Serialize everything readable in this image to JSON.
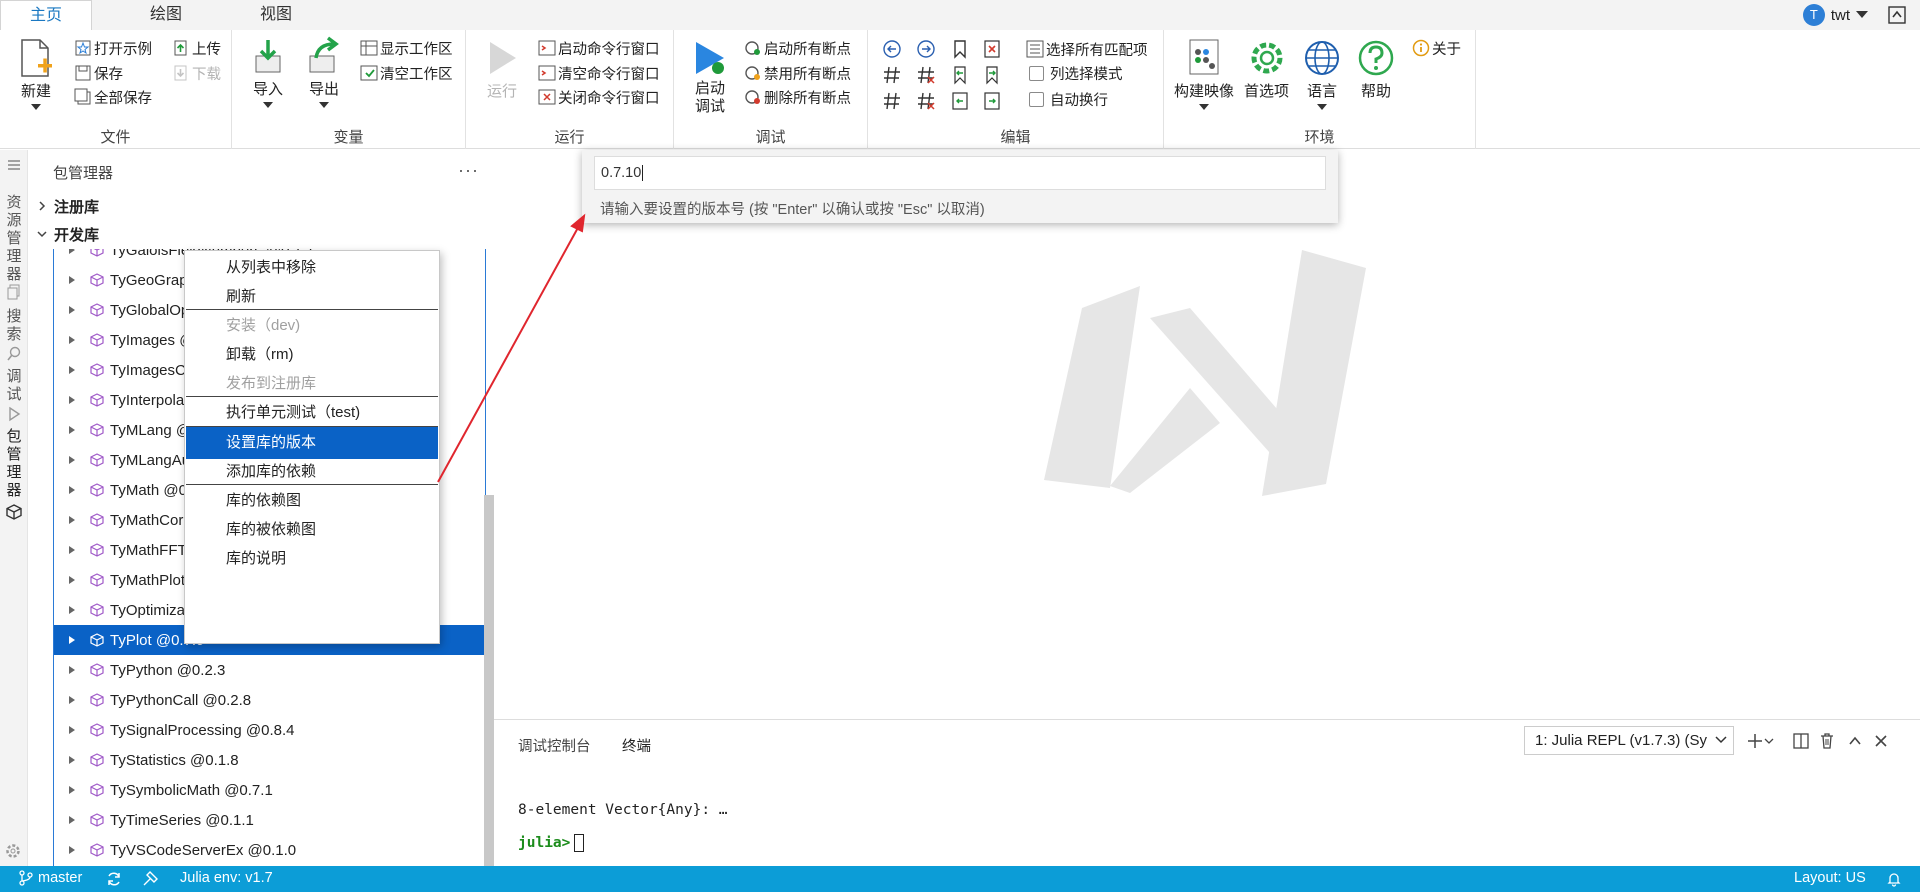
{
  "ribbon": {
    "tabs": [
      "主页",
      "绘图",
      "视图"
    ],
    "user": {
      "initial": "T",
      "name": "twt"
    },
    "groups": {
      "file": {
        "label": "文件",
        "new": "新建",
        "open_example": "打开示例",
        "save": "保存",
        "save_all": "全部保存",
        "upload": "上传",
        "download": "下载"
      },
      "variable": {
        "label": "变量",
        "import": "导入",
        "export": "导出",
        "show_workspace": "显示工作区",
        "clear_workspace": "清空工作区"
      },
      "run": {
        "label": "运行",
        "run": "运行",
        "start_cmd": "启动命令行窗口",
        "clear_cmd": "清空命令行窗口",
        "close_cmd": "关闭命令行窗口"
      },
      "debug": {
        "label": "调试",
        "start_debug": "启动调试",
        "enable_bp": "启动所有断点",
        "disable_bp": "禁用所有断点",
        "delete_bp": "删除所有断点"
      },
      "edit": {
        "label": "编辑",
        "select_all_matches": "选择所有匹配项",
        "column_select": "列选择模式",
        "word_wrap": "自动换行"
      },
      "env": {
        "label": "环境",
        "build_image": "构建映像",
        "preferences": "首选项",
        "language": "语言",
        "help": "帮助",
        "about": "关于"
      }
    }
  },
  "activity": [
    {
      "label": "资源管理器",
      "chars": [
        "资",
        "源",
        "管",
        "理",
        "器"
      ],
      "icon": "files-icon"
    },
    {
      "label": "搜索",
      "chars": [
        "搜",
        "索"
      ],
      "icon": "search-icon"
    },
    {
      "label": "调试",
      "chars": [
        "调",
        "试"
      ],
      "icon": "debug-icon"
    },
    {
      "label": "包管理器",
      "chars": [
        "包",
        "管",
        "理",
        "器"
      ],
      "icon": "package-icon"
    }
  ],
  "sidebar": {
    "title": "包管理器",
    "more": "···",
    "sections": {
      "registry": "注册库",
      "dev": "开发库"
    },
    "packages": [
      "TyGaloisFieldNumbers @0.1.1",
      "TyGeoGraphics @0.1.1",
      "TyGlobalOptimization @0.1.1",
      "TyImages @0.3.0",
      "TyImagesCore @0.1.0",
      "TyInterpolation @0.1.2",
      "TyMLang @0.1.0",
      "TyMLangAux @0.1.0",
      "TyMath @0.1.3",
      "TyMathCore @0.1.2",
      "TyMathFFT @0.1.1",
      "TyMathPlot @0.1.0",
      "TyOptimization @0.1.3",
      "TyPlot @0.7.9",
      "TyPython @0.2.3",
      "TyPythonCall @0.2.8",
      "TySignalProcessing @0.8.4",
      "TyStatistics @0.1.8",
      "TySymbolicMath @0.7.1",
      "TyTimeSeries @0.1.1",
      "TyVSCodeServerEx @0.1.0"
    ],
    "selected_index": 13
  },
  "context_menu": {
    "items": [
      {
        "label": "从列表中移除",
        "disabled": false
      },
      {
        "label": "刷新",
        "disabled": false
      },
      {
        "label": "安装（dev)",
        "disabled": true
      },
      {
        "label": "卸载（rm)",
        "disabled": false
      },
      {
        "label": "发布到注册库",
        "disabled": true
      },
      {
        "label": "执行单元测试（test)",
        "disabled": false
      },
      {
        "label": "设置库的版本",
        "disabled": false
      },
      {
        "label": "添加库的依赖",
        "disabled": false
      },
      {
        "label": "库的依赖图",
        "disabled": false
      },
      {
        "label": "库的被依赖图",
        "disabled": false
      },
      {
        "label": "库的说明",
        "disabled": false
      }
    ],
    "highlighted_index": 6
  },
  "quick_input": {
    "value": "0.7.10",
    "hint": "请输入要设置的版本号 (按 \"Enter\" 以确认或按 \"Esc\" 以取消)"
  },
  "panel": {
    "tabs": [
      "调试控制台",
      "终端"
    ],
    "terminal_select": "1: Julia REPL (v1.7.3) (Sy",
    "output_line": "8-element Vector{Any}: …",
    "prompt": "julia>"
  },
  "status": {
    "branch": "master",
    "env": "Julia env: v1.7",
    "layout": "Layout: US"
  },
  "colors": {
    "accent": "#0a62c6",
    "status_bar": "#0c9dd7",
    "annotation_arrow": "#e0262e"
  }
}
